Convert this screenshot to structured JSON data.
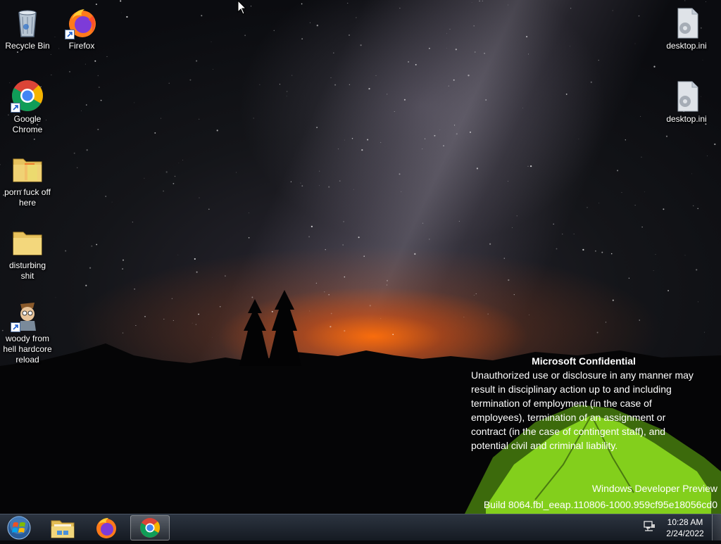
{
  "desktop": {
    "icons": [
      {
        "label": "Recycle Bin",
        "icon": "recycle-bin-icon",
        "shortcut": false
      },
      {
        "label": "Firefox",
        "icon": "firefox-icon",
        "shortcut": true
      },
      {
        "label": "Google Chrome",
        "icon": "chrome-icon",
        "shortcut": true
      },
      {
        "label": "porn fuck off here",
        "icon": "folder-icon",
        "shortcut": false
      },
      {
        "label": "disturbing shit",
        "icon": "folder-icon",
        "shortcut": false
      },
      {
        "label": "woody from hell hardcore reload",
        "icon": "woody-game-icon",
        "shortcut": true
      },
      {
        "label": "desktop.ini",
        "icon": "settings-file-icon",
        "shortcut": false
      },
      {
        "label": "desktop.ini",
        "icon": "settings-file-icon",
        "shortcut": false
      }
    ]
  },
  "watermark": {
    "title": "Microsoft Confidential",
    "lines": [
      "Unauthorized use or disclosure in any manner may",
      "result in disciplinary action up to and including",
      "termination of employment (in the case of",
      "employees), termination of an assignment or",
      "contract (in the case of contingent staff), and",
      "potential civil and criminal liability."
    ],
    "edition": "Windows Developer Preview",
    "build": "Build 8064.fbl_eeap.110806-1000.959cf95e18056cd0"
  },
  "taskbar": {
    "start_icon": "windows-start-orb-icon",
    "pinned": [
      {
        "icon": "file-explorer-icon",
        "active": false
      },
      {
        "icon": "firefox-icon",
        "active": false
      },
      {
        "icon": "chrome-icon",
        "active": true
      }
    ],
    "tray_icon": "network-icon",
    "clock": {
      "time": "10:28 AM",
      "date": "2/24/2022"
    }
  },
  "colors": {
    "taskbar_bg": "#1b212b",
    "horizon_glow": "#ff6a0a",
    "tent_green": "#8fe020"
  }
}
